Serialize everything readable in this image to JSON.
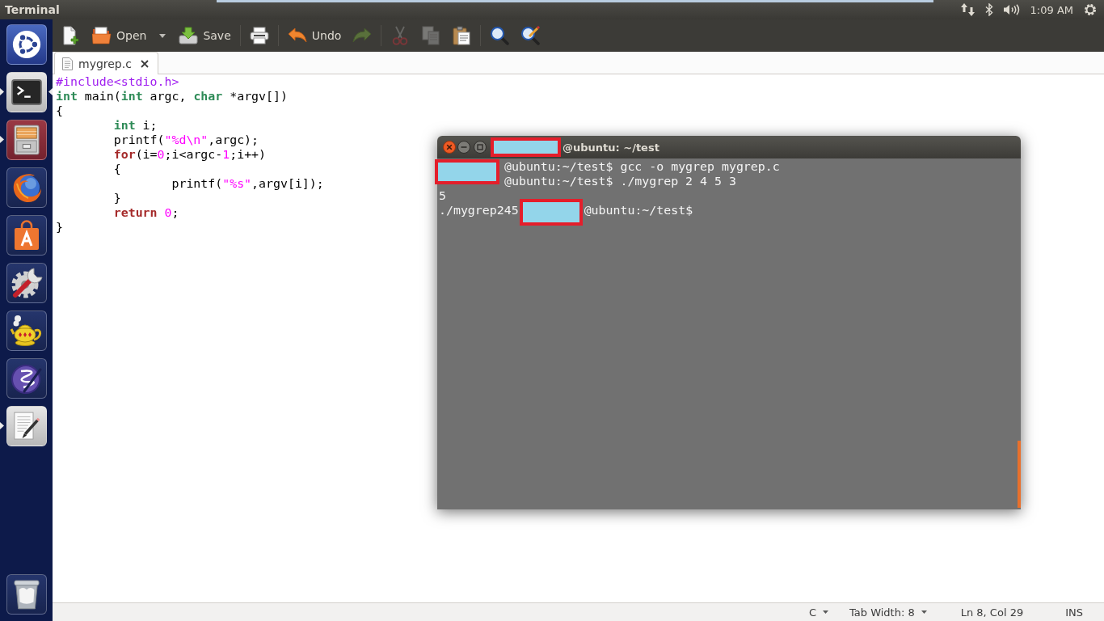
{
  "top_panel": {
    "app_title": "Terminal",
    "clock": "1:09 AM"
  },
  "launcher": {
    "items": [
      {
        "kind": "dash",
        "running": false,
        "focused": false
      },
      {
        "kind": "terminal",
        "running": true,
        "focused": true
      },
      {
        "kind": "files",
        "running": true,
        "focused": false
      },
      {
        "kind": "browser",
        "running": false,
        "focused": false
      },
      {
        "kind": "store",
        "running": false,
        "focused": false
      },
      {
        "kind": "settings",
        "running": false,
        "focused": false
      },
      {
        "kind": "teapot",
        "running": false,
        "focused": false
      },
      {
        "kind": "emacs",
        "running": false,
        "focused": false
      },
      {
        "kind": "editor",
        "running": true,
        "focused": false
      },
      {
        "kind": "trash",
        "running": false,
        "focused": false
      }
    ]
  },
  "editor": {
    "toolbar": {
      "groups": [
        {
          "buttons": [
            {
              "kind": "new",
              "disabled": false
            },
            {
              "kind": "open",
              "label": "Open",
              "disabled": false
            },
            {
              "kind": "menu",
              "disabled": false
            },
            {
              "kind": "save",
              "label": "Save",
              "disabled": false
            }
          ]
        },
        {
          "buttons": [
            {
              "kind": "print",
              "disabled": false
            }
          ]
        },
        {
          "buttons": [
            {
              "kind": "undo",
              "label": "Undo",
              "disabled": false
            },
            {
              "kind": "redo",
              "disabled": true
            }
          ]
        },
        {
          "buttons": [
            {
              "kind": "cut",
              "disabled": true
            },
            {
              "kind": "copy",
              "disabled": true
            },
            {
              "kind": "paste",
              "disabled": false
            }
          ]
        },
        {
          "buttons": [
            {
              "kind": "find",
              "disabled": false
            },
            {
              "kind": "replace",
              "disabled": false
            }
          ]
        }
      ]
    },
    "tabs": [
      {
        "label": "mygrep.c",
        "selected": true
      }
    ],
    "code_lines": [
      {
        "tokens": [
          {
            "kind": "preproc",
            "text": "#include<stdio.h>"
          }
        ]
      },
      {
        "tokens": [
          {
            "kind": "type",
            "text": "int"
          },
          {
            "kind": "plain",
            "text": " main("
          },
          {
            "kind": "type",
            "text": "int"
          },
          {
            "kind": "plain",
            "text": " argc, "
          },
          {
            "kind": "type",
            "text": "char"
          },
          {
            "kind": "plain",
            "text": " *argv[])"
          }
        ]
      },
      {
        "tokens": [
          {
            "kind": "plain",
            "text": "{"
          }
        ]
      },
      {
        "tokens": [
          {
            "kind": "type",
            "text": "\tint"
          },
          {
            "kind": "plain",
            "text": " i;"
          }
        ]
      },
      {
        "tokens": [
          {
            "kind": "plain",
            "text": "\tprintf("
          },
          {
            "kind": "string",
            "text": "\"%d\\n\""
          },
          {
            "kind": "plain",
            "text": ",argc);"
          }
        ]
      },
      {
        "tokens": [
          {
            "kind": "keyword",
            "text": "\tfor"
          },
          {
            "kind": "plain",
            "text": "(i="
          },
          {
            "kind": "number",
            "text": "0"
          },
          {
            "kind": "plain",
            "text": ";i<argc-"
          },
          {
            "kind": "number",
            "text": "1"
          },
          {
            "kind": "plain",
            "text": ";i++)"
          }
        ]
      },
      {
        "tokens": [
          {
            "kind": "plain",
            "text": "\t{"
          }
        ]
      },
      {
        "tokens": [
          {
            "kind": "plain",
            "text": "\t\tprintf("
          },
          {
            "kind": "string",
            "text": "\"%s\""
          },
          {
            "kind": "plain",
            "text": ",argv[i]);"
          }
        ]
      },
      {
        "tokens": [
          {
            "kind": "plain",
            "text": "\t}"
          }
        ]
      },
      {
        "tokens": [
          {
            "kind": "keyword",
            "text": "\treturn"
          },
          {
            "kind": "number",
            "text": " 0"
          },
          {
            "kind": "plain",
            "text": ";"
          }
        ]
      },
      {
        "tokens": [
          {
            "kind": "plain",
            "text": "}"
          }
        ]
      }
    ],
    "status_bar": {
      "items": [
        {
          "kind": "dropdown",
          "text": "C"
        },
        {
          "kind": "dropdown",
          "text": "Tab Width: 8"
        },
        {
          "kind": "label",
          "text": "Ln 8, Col 29"
        },
        {
          "kind": "label",
          "text": "INS"
        }
      ]
    }
  },
  "terminal": {
    "title": [
      {
        "kind": "redacted"
      },
      {
        "kind": "text",
        "text": "@ubuntu: ~/test"
      }
    ],
    "lines": [
      {
        "segments": [
          {
            "kind": "redacted"
          },
          {
            "kind": "text",
            "text": "@ubuntu:~/test$ gcc -o mygrep mygrep.c"
          }
        ]
      },
      {
        "segments": [
          {
            "kind": "covered"
          },
          {
            "kind": "text",
            "text": "@ubuntu:~/test$ ./mygrep 2 4 5 3"
          }
        ]
      },
      {
        "segments": [
          {
            "kind": "text",
            "text": "5"
          }
        ]
      },
      {
        "segments": [
          {
            "kind": "text",
            "text": "./mygrep245"
          },
          {
            "kind": "redacted"
          },
          {
            "kind": "text",
            "text": "@ubuntu:~/test$"
          }
        ]
      }
    ]
  }
}
